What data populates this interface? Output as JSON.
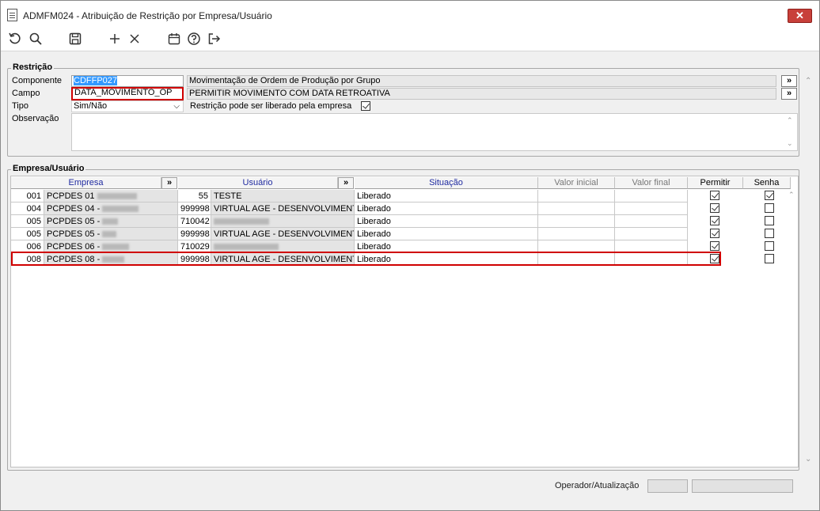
{
  "window": {
    "title": "ADMFM024 - Atribuição de Restrição por Empresa/Usuário",
    "close_label": "✕"
  },
  "toolbar": {
    "icons": [
      "refresh-icon",
      "search-icon",
      "save-icon",
      "add-icon",
      "cancel-icon",
      "calendar-icon",
      "help-icon",
      "exit-icon"
    ]
  },
  "restricao": {
    "title": "Restrição",
    "componente_label": "Componente",
    "componente_value": "CDFFP027",
    "componente_desc": "Movimentação de Ordem de Produção por Grupo",
    "campo_label": "Campo",
    "campo_value": "DATA_MOVIMENTO_OP",
    "campo_desc": "PERMITIR MOVIMENTO COM DATA RETROATIVA",
    "tipo_label": "Tipo",
    "tipo_value": "Sim/Não",
    "liberado_label": "Restrição pode ser liberado pela empresa",
    "liberado_checked": true,
    "observacao_label": "Observação",
    "observacao_value": "",
    "search_button_label": "»"
  },
  "empresa_usuario": {
    "title": "Empresa/Usuário",
    "columns": [
      "Empresa",
      "Usuário",
      "Situação",
      "Valor inicial",
      "Valor final",
      "Permitir",
      "Senha"
    ],
    "expand_label": "»",
    "rows": [
      {
        "emp_code": "001",
        "emp_name": "PCPDES 01",
        "user_code": "55",
        "user_name": "TESTE",
        "situacao": "Liberado",
        "valor_inicial": "",
        "valor_final": "",
        "permitir": true,
        "senha": true
      },
      {
        "emp_code": "004",
        "emp_name": "PCPDES 04 -",
        "user_code": "999998",
        "user_name": "VIRTUAL AGE - DESENVOLVIMENTO",
        "situacao": "Liberado",
        "valor_inicial": "",
        "valor_final": "",
        "permitir": true,
        "senha": false
      },
      {
        "emp_code": "005",
        "emp_name": "PCPDES 05 -",
        "user_code": "710042",
        "user_name": "",
        "situacao": "Liberado",
        "valor_inicial": "",
        "valor_final": "",
        "permitir": true,
        "senha": false
      },
      {
        "emp_code": "005",
        "emp_name": "PCPDES 05 -",
        "user_code": "999998",
        "user_name": "VIRTUAL AGE - DESENVOLVIMENTO",
        "situacao": "Liberado",
        "valor_inicial": "",
        "valor_final": "",
        "permitir": true,
        "senha": false
      },
      {
        "emp_code": "006",
        "emp_name": "PCPDES 06 -",
        "user_code": "710029",
        "user_name": "",
        "situacao": "Liberado",
        "valor_inicial": "",
        "valor_final": "",
        "permitir": true,
        "senha": false
      },
      {
        "emp_code": "008",
        "emp_name": "PCPDES 08 -",
        "user_code": "999998",
        "user_name": "VIRTUAL AGE - DESENVOLVIMENTO",
        "situacao": "Liberado",
        "valor_inicial": "",
        "valor_final": "",
        "permitir": true,
        "senha": false
      }
    ]
  },
  "status": {
    "operador_label": "Operador/Atualização",
    "operador_value": "",
    "atualizacao_value": ""
  }
}
